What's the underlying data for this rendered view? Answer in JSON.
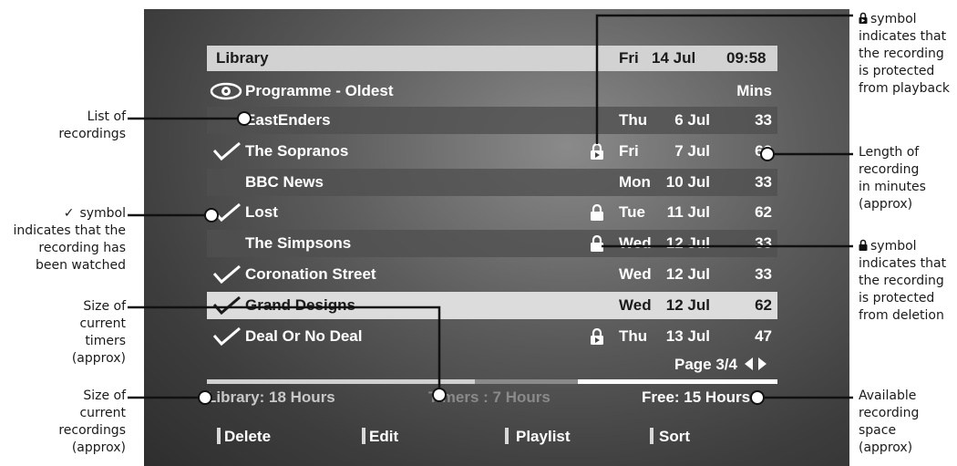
{
  "header": {
    "title": "Library",
    "day": "Fri",
    "date": "14 Jul",
    "time": "09:58"
  },
  "columns": {
    "title": "Programme - Oldest",
    "mins": "Mins"
  },
  "recordings": [
    {
      "title": "EastEnders",
      "day": "Thu",
      "date": "6 Jul",
      "mins": "33",
      "watched": false,
      "icon": ""
    },
    {
      "title": "The Sopranos",
      "day": "Fri",
      "date": "7 Jul",
      "mins": "62",
      "watched": true,
      "icon": "playback-lock-icon"
    },
    {
      "title": "BBC News",
      "day": "Mon",
      "date": "10 Jul",
      "mins": "33",
      "watched": false,
      "icon": ""
    },
    {
      "title": "Lost",
      "day": "Tue",
      "date": "11 Jul",
      "mins": "62",
      "watched": true,
      "icon": "padlock-icon"
    },
    {
      "title": "The Simpsons",
      "day": "Wed",
      "date": "12 Jul",
      "mins": "33",
      "watched": false,
      "icon": "padlock-icon"
    },
    {
      "title": "Coronation Street",
      "day": "Wed",
      "date": "12 Jul",
      "mins": "33",
      "watched": true,
      "icon": ""
    },
    {
      "title": "Grand Designs",
      "day": "Wed",
      "date": "12 Jul",
      "mins": "62",
      "watched": true,
      "icon": "",
      "selected": true
    },
    {
      "title": "Deal Or No Deal",
      "day": "Thu",
      "date": "13 Jul",
      "mins": "47",
      "watched": true,
      "icon": "playback-lock-icon"
    }
  ],
  "page": {
    "label": "Page 3/4"
  },
  "usage": {
    "library": "Library: 18 Hours",
    "timers": "Timers : 7 Hours",
    "free": "Free: 15 Hours",
    "recordings_fraction": 0.47,
    "timers_fraction": 0.18,
    "free_fraction": 0.35
  },
  "buttons": {
    "delete": "Delete",
    "edit": "Edit",
    "playlist": "Playlist",
    "sort": "Sort"
  },
  "annotations": {
    "list_of_recordings": [
      "List of",
      "recordings"
    ],
    "watched_symbol": [
      "symbol",
      "indicates that the",
      "recording has",
      "been watched"
    ],
    "timers_size": [
      "Size of",
      "current",
      "timers",
      "(approx)"
    ],
    "recordings_size": [
      "Size of",
      "current",
      "recordings",
      "(approx)"
    ],
    "playback_lock": [
      "symbol",
      "indicates that",
      "the recording",
      "is protected",
      "from playback"
    ],
    "length": [
      "Length of",
      "recording",
      "in minutes",
      "(approx)"
    ],
    "deletion_lock": [
      "symbol",
      "indicates that",
      "the recording",
      "is protected",
      "from deletion"
    ],
    "available_space": [
      "Available",
      "recording",
      "space",
      "(approx)"
    ]
  },
  "colors": {
    "bar_library": "#d0d0d0",
    "bar_timers": "#8a8a8a",
    "bar_free": "#ffffff",
    "row_band": "#505050",
    "selected_row": "#dcdcdc"
  }
}
